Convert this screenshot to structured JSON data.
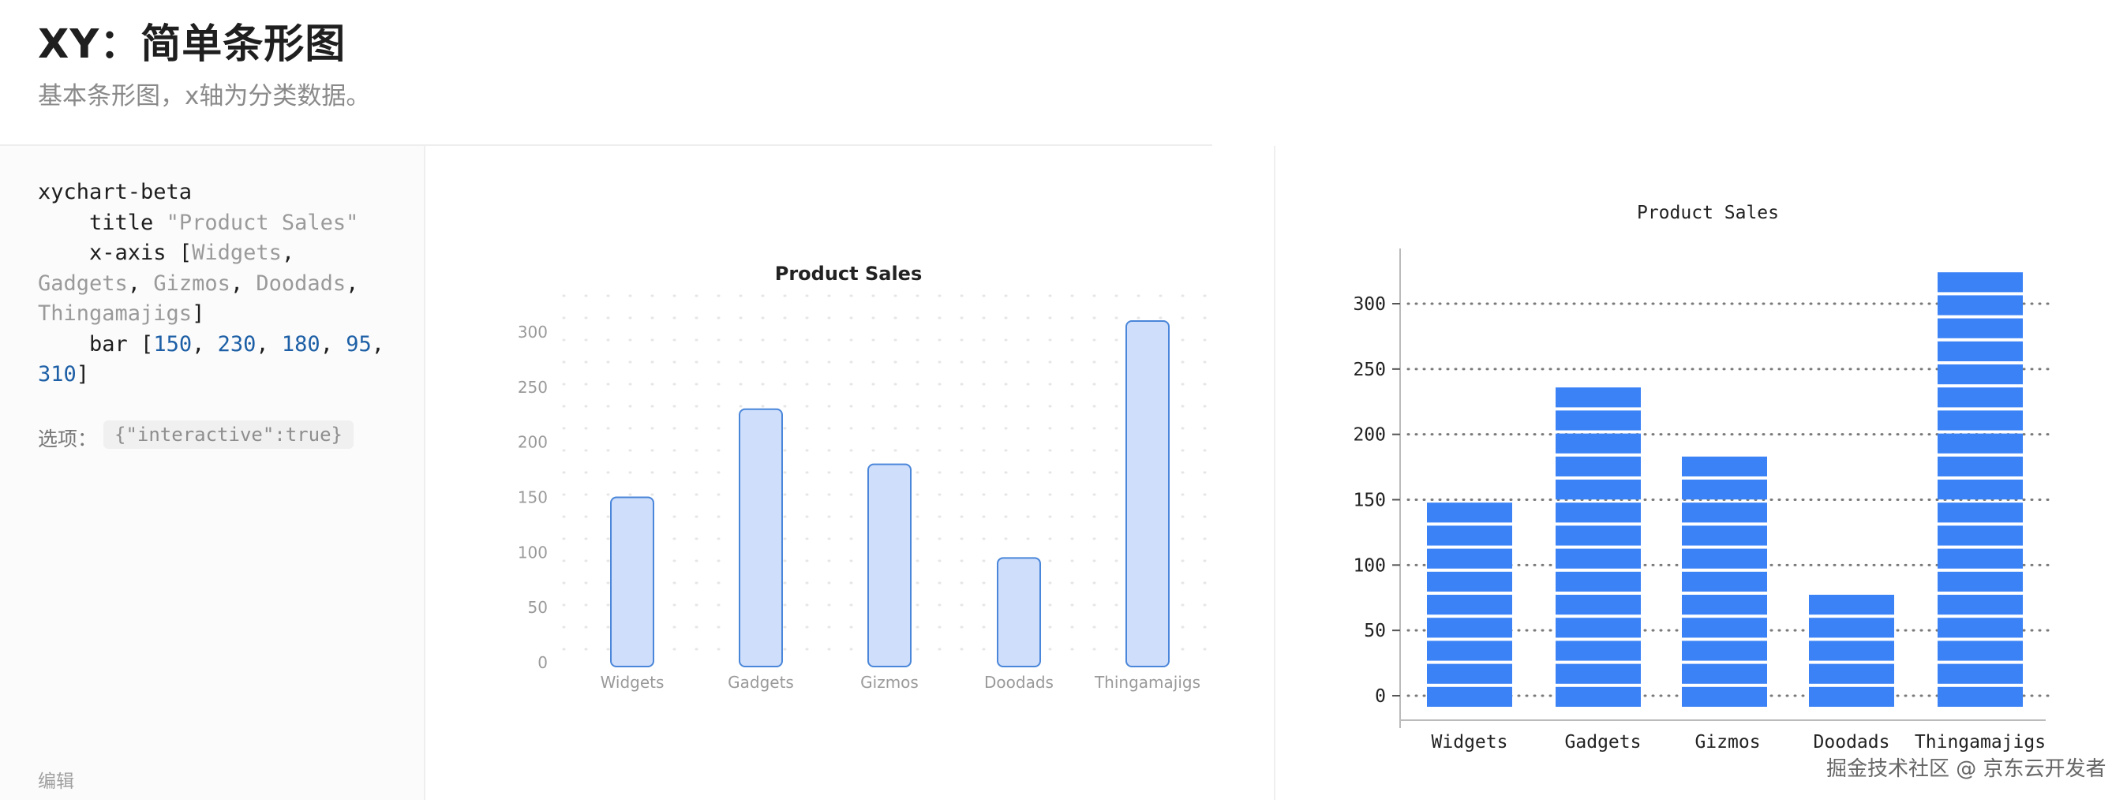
{
  "page": {
    "title": "XY：简单条形图",
    "subtitle": "基本条形图，x轴为分类数据。"
  },
  "editor": {
    "code_lines": [
      {
        "parts": [
          {
            "t": "xychart-beta",
            "c": ""
          }
        ]
      },
      {
        "parts": [
          {
            "t": "    title ",
            "c": ""
          },
          {
            "t": "\"Product Sales\"",
            "c": "str"
          }
        ]
      },
      {
        "parts": [
          {
            "t": "    x-axis [",
            "c": ""
          },
          {
            "t": "Widgets",
            "c": "str"
          },
          {
            "t": ",",
            "c": ""
          }
        ]
      },
      {
        "parts": [
          {
            "t": "Gadgets",
            "c": "str"
          },
          {
            "t": ", ",
            "c": ""
          },
          {
            "t": "Gizmos",
            "c": "str"
          },
          {
            "t": ", ",
            "c": ""
          },
          {
            "t": "Doodads",
            "c": "str"
          },
          {
            "t": ",",
            "c": ""
          }
        ]
      },
      {
        "parts": [
          {
            "t": "Thingamajigs",
            "c": "str"
          },
          {
            "t": "]",
            "c": ""
          }
        ]
      },
      {
        "parts": [
          {
            "t": "    bar [",
            "c": ""
          },
          {
            "t": "150",
            "c": "num"
          },
          {
            "t": ", ",
            "c": ""
          },
          {
            "t": "230",
            "c": "num"
          },
          {
            "t": ", ",
            "c": ""
          },
          {
            "t": "180",
            "c": "num"
          },
          {
            "t": ", ",
            "c": ""
          },
          {
            "t": "95",
            "c": "num"
          },
          {
            "t": ",",
            "c": ""
          }
        ]
      },
      {
        "parts": [
          {
            "t": "310",
            "c": "num"
          },
          {
            "t": "]",
            "c": ""
          }
        ]
      }
    ],
    "options_label": "选项：",
    "options_value": "{\"interactive\":true}",
    "edit_label": "编辑"
  },
  "watermark": "掘金技术社区 @ 京东云开发者",
  "chart_data": [
    {
      "type": "bar",
      "title": "Product Sales",
      "categories": [
        "Widgets",
        "Gadgets",
        "Gizmos",
        "Doodads",
        "Thingamajigs"
      ],
      "values": [
        150,
        230,
        180,
        95,
        310
      ],
      "yticks": [
        0,
        50,
        100,
        150,
        200,
        250,
        300
      ],
      "ylim": [
        0,
        330
      ],
      "grid": "dotted",
      "colors": {
        "bar_fill": "#cfdefb",
        "bar_stroke": "#4a86d9",
        "text": "#9a9a9a",
        "title": "#222222"
      }
    },
    {
      "type": "bar",
      "title": "Product Sales",
      "categories": [
        "Widgets",
        "Gadgets",
        "Gizmos",
        "Doodads",
        "Thingamajigs"
      ],
      "values": [
        160,
        240,
        185,
        90,
        330
      ],
      "yticks": [
        0,
        50,
        100,
        150,
        200,
        250,
        300
      ],
      "ylim": [
        0,
        330
      ],
      "grid": "dotted",
      "colors": {
        "bar_fill": "#3b82f6",
        "text": "#222222",
        "grid": "#7a7a7a"
      }
    }
  ]
}
